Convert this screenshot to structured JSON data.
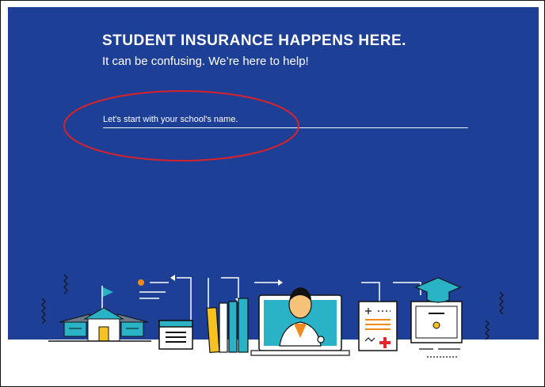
{
  "hero": {
    "headline": "STUDENT INSURANCE HAPPENS HERE.",
    "subhead": "It can be confusing. We’re here to help!"
  },
  "search": {
    "placeholder": "Let's start with your school's name.",
    "value": ""
  },
  "colors": {
    "background": "#1e3f96",
    "text": "#ffffff",
    "annotation": "#d8222a",
    "accent_teal": "#2ab3c6",
    "accent_yellow": "#f5c222",
    "accent_orange": "#f08a1c",
    "accent_red": "#e5252b"
  },
  "illustration": {
    "icons": [
      "school-icon",
      "calendar-icon",
      "books-icon",
      "laptop-doctor-icon",
      "medical-chart-icon",
      "diploma-icon"
    ]
  }
}
